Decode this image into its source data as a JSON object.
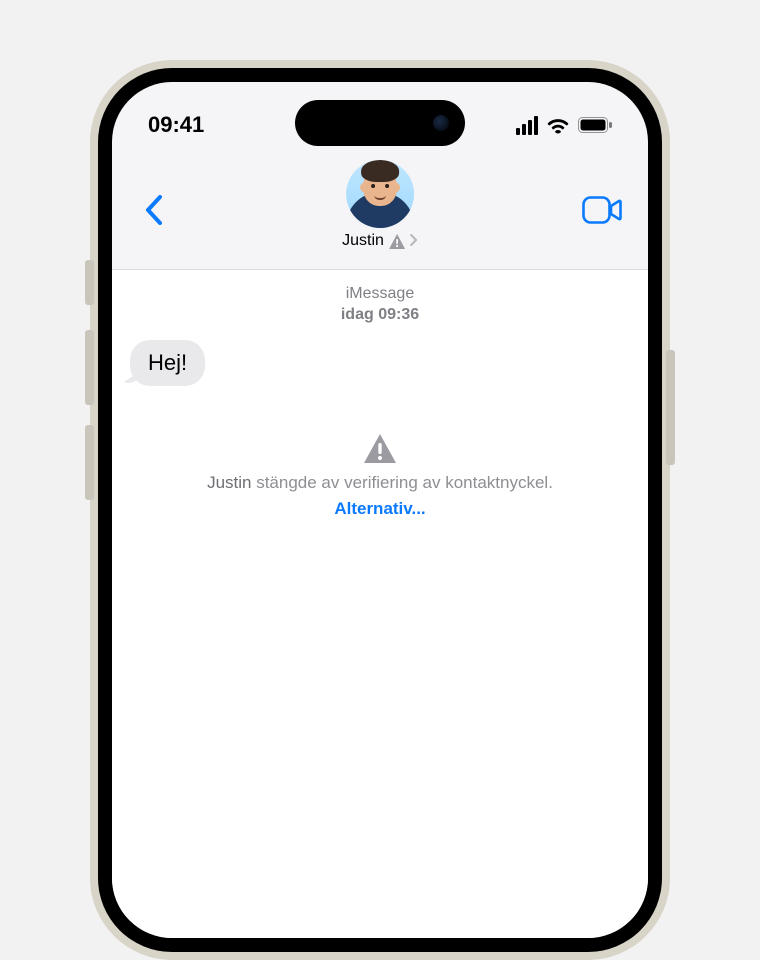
{
  "status": {
    "time": "09:41"
  },
  "header": {
    "contact_name": "Justin"
  },
  "thread": {
    "meta_service": "iMessage",
    "meta_datetime": "idag 09:36",
    "messages": [
      {
        "text": "Hej!"
      }
    ],
    "notice": {
      "name": "Justin",
      "rest": " stängde av verifiering av kontaktnyckel.",
      "options_label": "Alternativ..."
    }
  }
}
